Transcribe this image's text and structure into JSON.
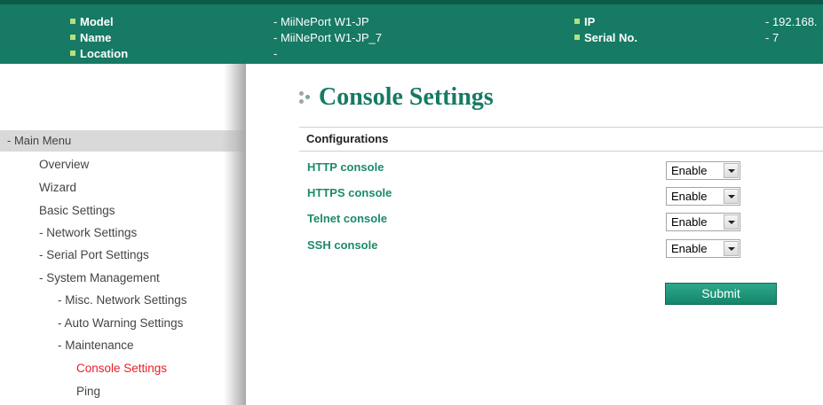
{
  "header": {
    "model_label": "Model",
    "model_value": "- MiiNePort W1-JP",
    "name_label": "Name",
    "name_value": "- MiiNePort W1-JP_7",
    "location_label": "Location",
    "location_value": "-",
    "ip_label": "IP",
    "ip_value": "- 192.168.",
    "serial_label": "Serial No.",
    "serial_value": "- 7"
  },
  "sidebar": {
    "menu_header": "- Main Menu",
    "items": [
      "Overview",
      "Wizard",
      "Basic Settings",
      "- Network Settings",
      "- Serial Port Settings",
      "- System Management",
      "- Misc. Network Settings",
      "- Auto Warning Settings",
      "- Maintenance",
      "Console Settings",
      "Ping"
    ]
  },
  "main": {
    "title": "Console Settings",
    "section": "Configurations",
    "fields": [
      {
        "label": "HTTP console",
        "value": "Enable"
      },
      {
        "label": "HTTPS console",
        "value": "Enable"
      },
      {
        "label": "Telnet console",
        "value": "Enable"
      },
      {
        "label": "SSH console",
        "value": "Enable"
      }
    ],
    "submit_label": "Submit"
  },
  "colors": {
    "header_bg": "#167a64",
    "accent_green": "#1b8a6c",
    "active_menu": "#e8202a",
    "bullet": "#b5e07b"
  }
}
